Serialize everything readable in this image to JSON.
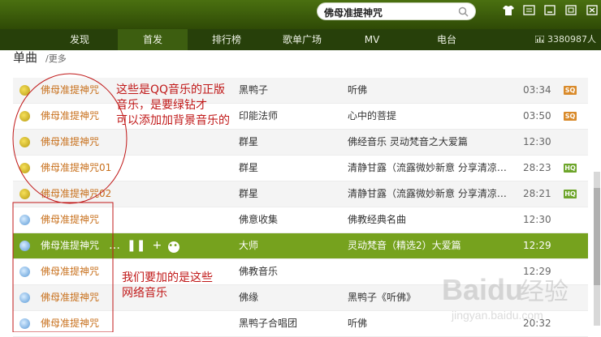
{
  "search": {
    "value": "佛母准提神咒"
  },
  "nav": {
    "tabs": [
      "发现",
      "首发",
      "排行榜",
      "歌单广场",
      "MV",
      "电台"
    ],
    "active_index": 1,
    "online_count": "3380987人"
  },
  "section": {
    "title": "单曲",
    "more": "/更多"
  },
  "songs": [
    {
      "name": "佛母准提神咒",
      "artist": "黑鸭子",
      "album": "听佛",
      "time": "03:34",
      "badge": "SQ",
      "source": "qq"
    },
    {
      "name": "佛母准提神咒",
      "artist": "印能法师",
      "album": "心中的菩提",
      "time": "03:50",
      "badge": "SQ",
      "source": "qq"
    },
    {
      "name": "佛母准提神咒",
      "artist": "群星",
      "album": "佛经音乐 灵动梵音之大爱篇",
      "time": "12:30",
      "badge": "",
      "source": "qq"
    },
    {
      "name": "佛母准提神咒01",
      "artist": "群星",
      "album": "清静甘露（流露微妙新意 分享清凉…",
      "time": "28:23",
      "badge": "HQ",
      "source": "qq"
    },
    {
      "name": "佛母准提神咒02",
      "artist": "群星",
      "album": "清静甘露（流露微妙新意 分享清凉…",
      "time": "28:21",
      "badge": "HQ",
      "source": "qq"
    },
    {
      "name": "佛母准提神咒",
      "artist": "佛意收集",
      "album": "佛教经典名曲",
      "time": "12:30",
      "badge": "",
      "source": "net"
    },
    {
      "name": "佛母准提神咒",
      "artist": "大师",
      "album": "灵动梵音（精选2）大爱篇",
      "time": "12:29",
      "badge": "",
      "source": "net",
      "playing": true
    },
    {
      "name": "佛母准提神咒",
      "artist": "佛教音乐",
      "album": "",
      "time": "12:29",
      "badge": "",
      "source": "net"
    },
    {
      "name": "佛母准提神咒",
      "artist": "佛缘",
      "album": "黑鸭子《听佛》",
      "time": "",
      "badge": "",
      "source": "net"
    },
    {
      "name": "佛母准提神咒",
      "artist": "黑鸭子合唱团",
      "album": "听佛",
      "time": "20:32",
      "badge": "",
      "source": "net"
    }
  ],
  "playing_controls": {
    "dots": "…",
    "pause": "❚❚",
    "add": "+",
    "more": "•••"
  },
  "annotations": {
    "top": [
      "这些是QQ音乐的正版",
      "音乐，是要绿钻才",
      "可以添加加背景音乐的"
    ],
    "bottom": [
      "我们要加的是这些",
      "网络音乐"
    ]
  },
  "colors": {
    "accent": "#76a21e",
    "nav_bg": "#27400a",
    "annotation": "#c01818",
    "song_name": "#c8701c"
  },
  "icons": {
    "qq_source": "qq-music-icon",
    "net_source": "network-music-icon"
  }
}
